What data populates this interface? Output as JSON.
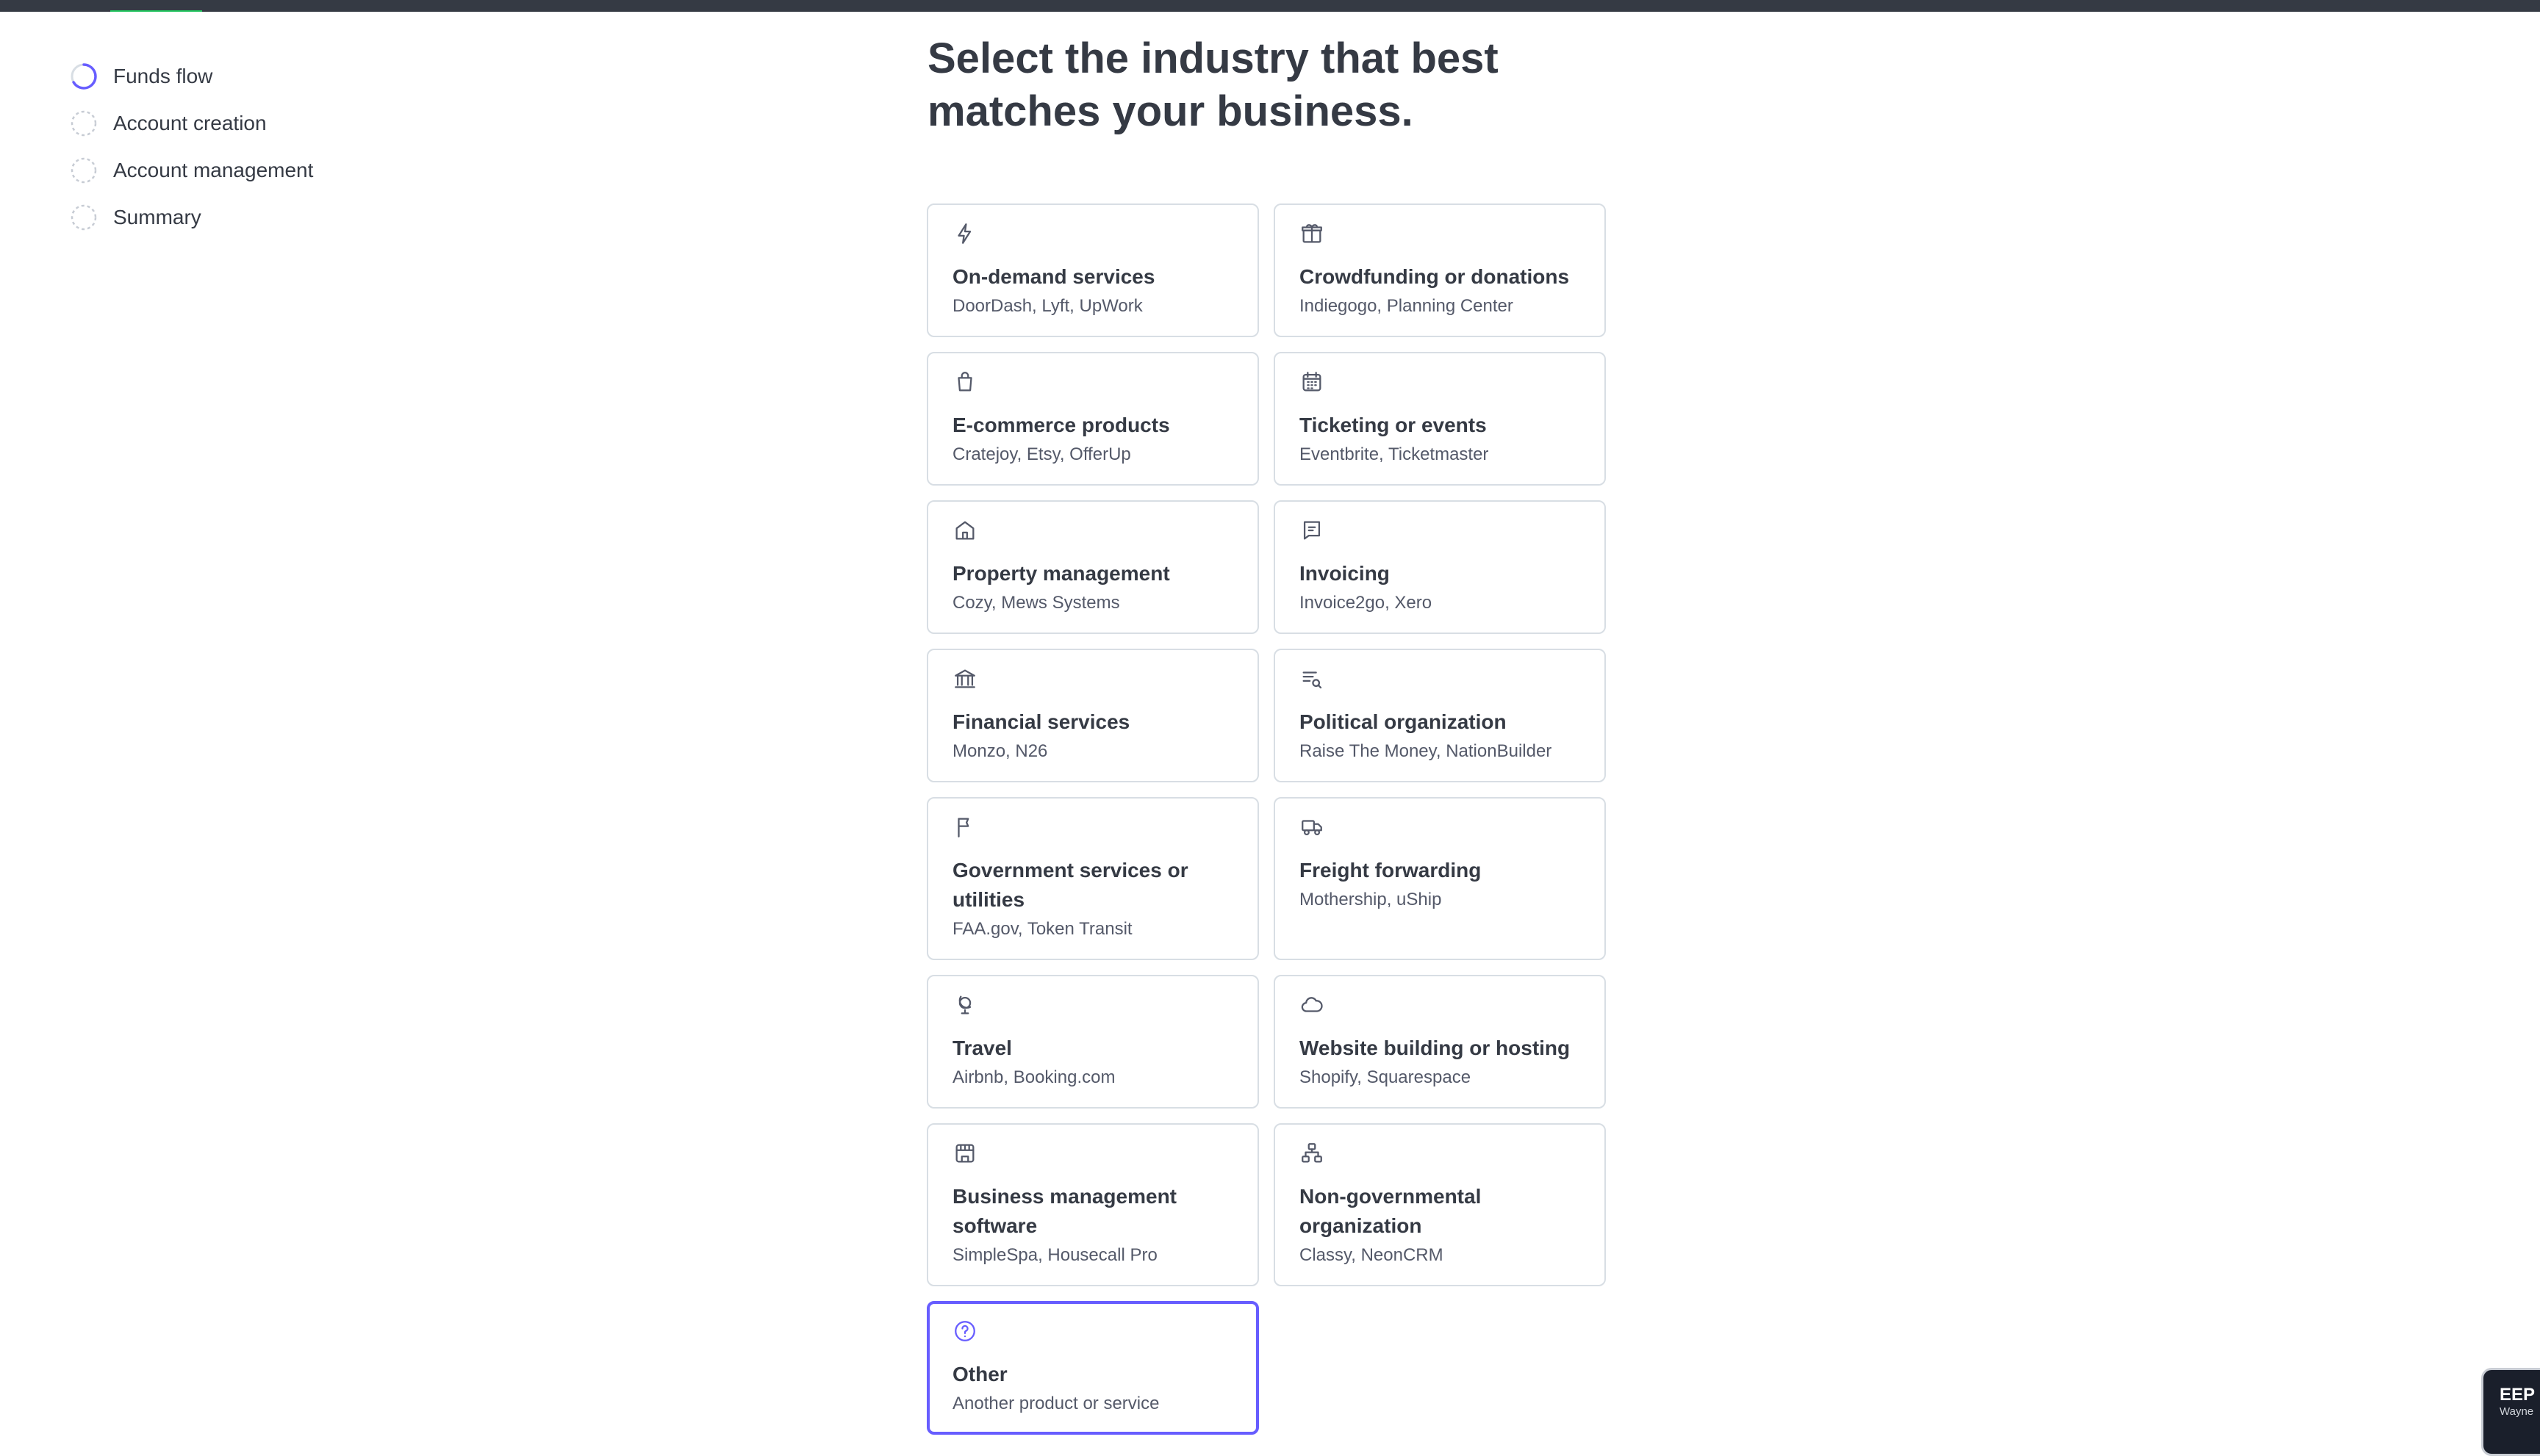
{
  "steps": [
    {
      "label": "Funds flow",
      "state": "in-progress"
    },
    {
      "label": "Account creation",
      "state": "pending"
    },
    {
      "label": "Account management",
      "state": "pending"
    },
    {
      "label": "Summary",
      "state": "pending"
    }
  ],
  "heading": "Select the industry that best matches your business.",
  "industries": [
    {
      "name": "On-demand services",
      "examples": "DoorDash, Lyft, UpWork",
      "icon": "lightning-icon"
    },
    {
      "name": "Crowdfunding or donations",
      "examples": "Indiegogo, Planning Center",
      "icon": "gift-icon"
    },
    {
      "name": "E-commerce products",
      "examples": "Cratejoy, Etsy, OfferUp",
      "icon": "shopping-bag-icon"
    },
    {
      "name": "Ticketing or events",
      "examples": "Eventbrite, Ticketmaster",
      "icon": "calendar-icon"
    },
    {
      "name": "Property management",
      "examples": "Cozy, Mews Systems",
      "icon": "home-icon"
    },
    {
      "name": "Invoicing",
      "examples": "Invoice2go, Xero",
      "icon": "invoice-icon"
    },
    {
      "name": "Financial services",
      "examples": "Monzo, N26",
      "icon": "bank-icon"
    },
    {
      "name": "Political organization",
      "examples": "Raise The Money, NationBuilder",
      "icon": "list-search-icon"
    },
    {
      "name": "Government services or utilities",
      "examples": "FAA.gov, Token Transit",
      "icon": "flag-icon"
    },
    {
      "name": "Freight forwarding",
      "examples": "Mothership, uShip",
      "icon": "truck-icon"
    },
    {
      "name": "Travel",
      "examples": "Airbnb, Booking.com",
      "icon": "globe-icon"
    },
    {
      "name": "Website building or hosting",
      "examples": "Shopify, Squarespace",
      "icon": "cloud-icon"
    },
    {
      "name": "Business management software",
      "examples": "SimpleSpa, Housecall Pro",
      "icon": "storefront-icon"
    },
    {
      "name": "Non-governmental organization",
      "examples": "Classy, NeonCRM",
      "icon": "org-chart-icon"
    },
    {
      "name": "Other",
      "examples": "Another product or service",
      "icon": "question-icon",
      "selected": true
    }
  ],
  "corner_badge": {
    "line1": "EEP C",
    "line2": "Wayne"
  },
  "colors": {
    "accent": "#675dff",
    "text": "#353a44",
    "border": "#d8dee4",
    "topbar": "#353a44"
  }
}
